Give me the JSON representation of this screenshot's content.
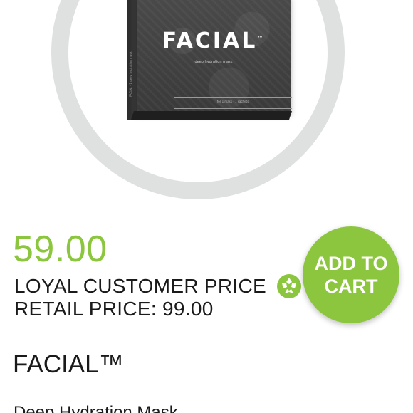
{
  "product_image": {
    "brand": "FACIAL",
    "trademark": "™",
    "subtitle": "deep hydration mask",
    "spine_text": "FACIAL · 1 deep hydration mask",
    "count_text": "for 1 mask · 1 sachets"
  },
  "pricing": {
    "loyal_price": "59.00",
    "loyal_label": "LOYAL CUSTOMER PRICE",
    "retail_text": "RETAIL PRICE: 99.00"
  },
  "cart": {
    "button_label": "ADD TO CART"
  },
  "product": {
    "name": "FACIAL™",
    "description": "Deep Hydration Mask"
  },
  "colors": {
    "accent": "#8cc63e",
    "ring": "#dfe1e0",
    "text": "#1a1a1a"
  },
  "icons": {
    "loyal_badge": "loyal-customer-icon"
  }
}
